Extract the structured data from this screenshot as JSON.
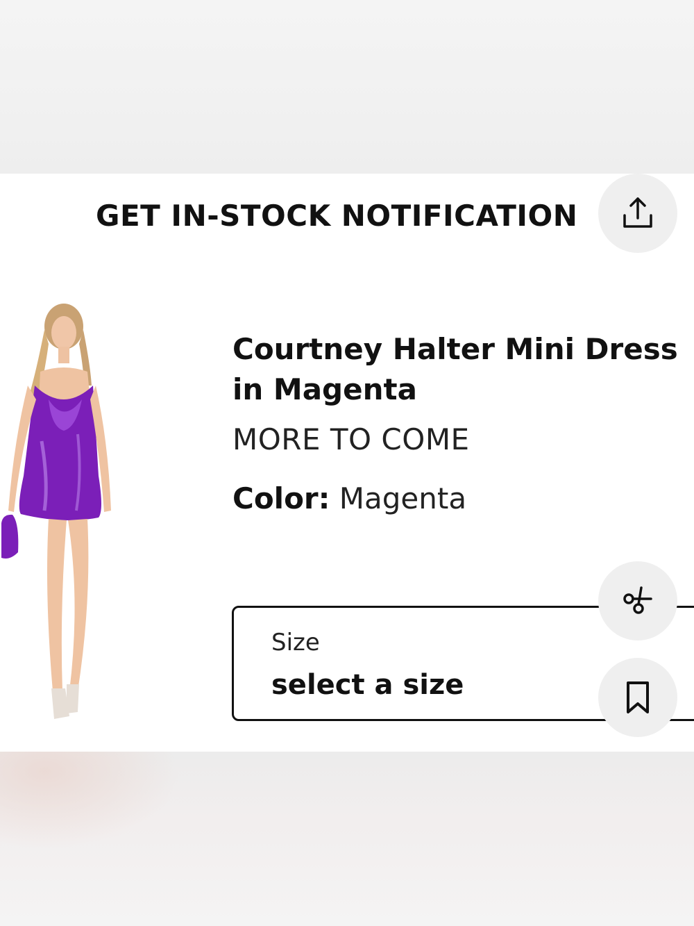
{
  "notification": {
    "label": "GET IN-STOCK NOTIFICATION"
  },
  "product": {
    "title": "Courtney Halter Mini Dress in Magenta",
    "brand": "MORE TO COME",
    "color_label": "Color:",
    "color_value": "Magenta",
    "image_icon": "model-wearing-purple-satin-dress"
  },
  "size": {
    "label": "Size",
    "value": "select a size"
  },
  "actions": {
    "share_icon": "share-icon",
    "fit_icon": "scissors-fit-icon",
    "save_icon": "bookmark-icon"
  },
  "colors": {
    "dress": "#7b1fb8",
    "text": "#111111",
    "button_bg": "#efefef"
  }
}
